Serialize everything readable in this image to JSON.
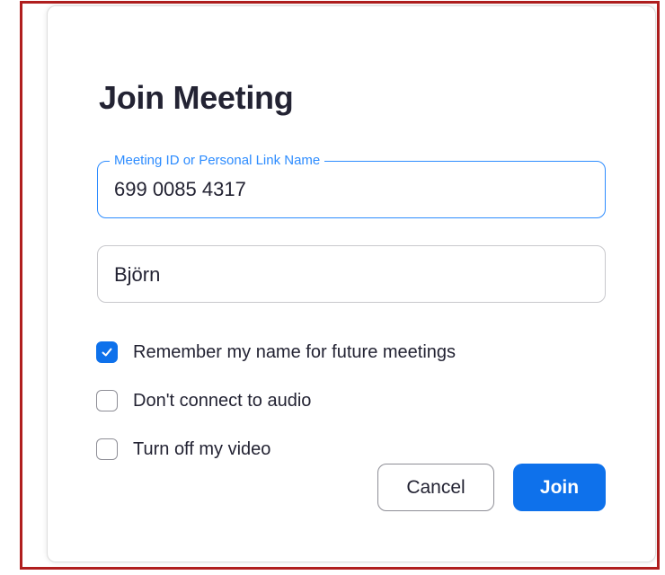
{
  "dialog": {
    "title": "Join Meeting"
  },
  "meeting_id_field": {
    "label": "Meeting ID or Personal Link Name",
    "value": "699 0085 4317"
  },
  "name_field": {
    "value": "Björn"
  },
  "options": [
    {
      "label": "Remember my name for future meetings",
      "checked": true
    },
    {
      "label": "Don't connect to audio",
      "checked": false
    },
    {
      "label": "Turn off my video",
      "checked": false
    }
  ],
  "buttons": {
    "cancel_label": "Cancel",
    "join_label": "Join"
  },
  "colors": {
    "accent": "#0e71eb",
    "focus_border": "#2d8cff",
    "text": "#232333",
    "frame": "#b01e1e"
  }
}
